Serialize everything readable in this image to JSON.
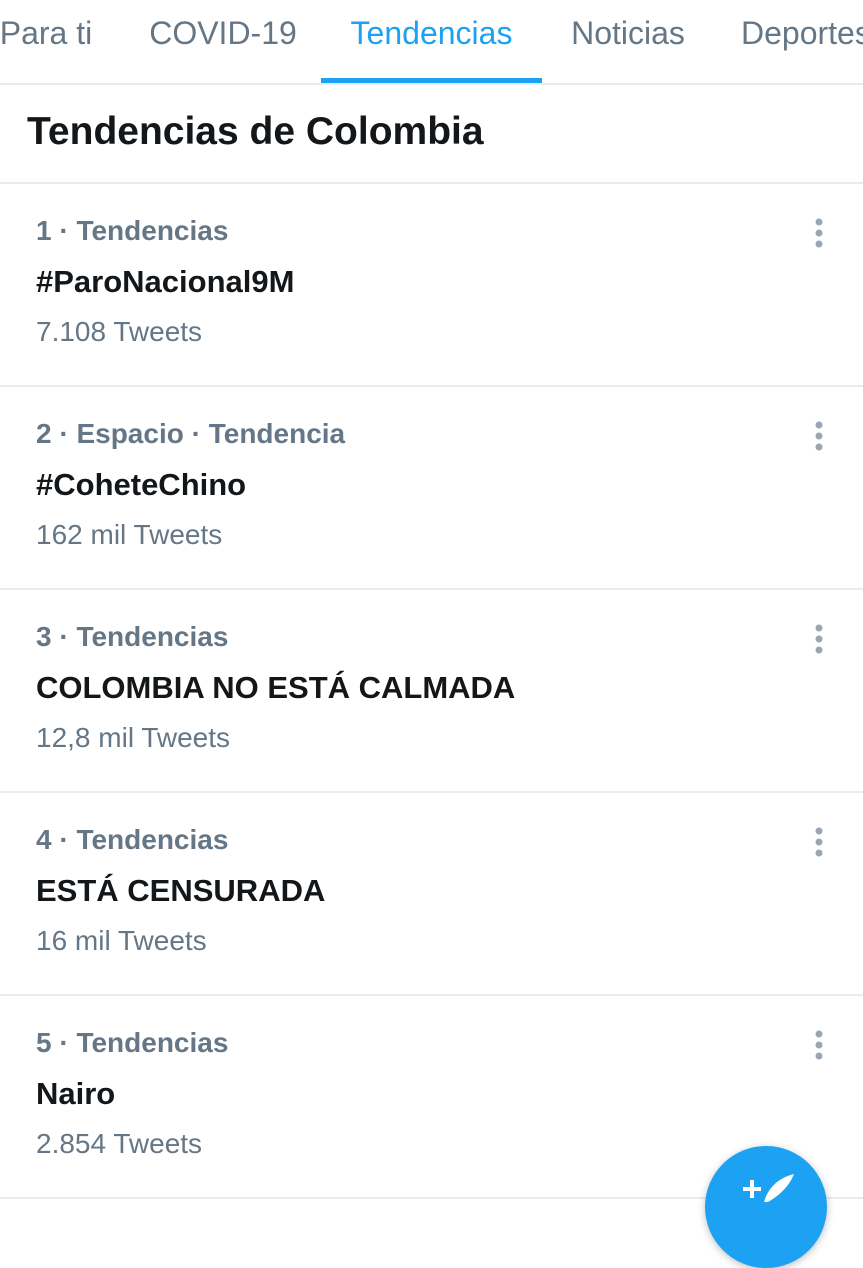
{
  "tabs": [
    {
      "label": "Para ti",
      "active": false
    },
    {
      "label": "COVID-19",
      "active": false
    },
    {
      "label": "Tendencias",
      "active": true
    },
    {
      "label": "Noticias",
      "active": false
    },
    {
      "label": "Deportes",
      "active": false
    }
  ],
  "section": {
    "title": "Tendencias de Colombia"
  },
  "trends": [
    {
      "meta": "1 · Tendencias",
      "name": "#ParoNacional9M",
      "count": "7.108 Tweets"
    },
    {
      "meta": "2 · Espacio · Tendencia",
      "name": "#CoheteChino",
      "count": "162 mil Tweets"
    },
    {
      "meta": "3 · Tendencias",
      "name": "COLOMBIA NO ESTÁ CALMADA",
      "count": "12,8 mil Tweets"
    },
    {
      "meta": "4 · Tendencias",
      "name": "ESTÁ CENSURADA",
      "count": "16 mil Tweets"
    },
    {
      "meta": "5 · Tendencias",
      "name": "Nairo",
      "count": "2.854 Tweets"
    }
  ],
  "icons": {
    "more": "more-vertical-icon",
    "compose": "compose-tweet-icon"
  },
  "colors": {
    "accent": "#1da1f2",
    "secondary_text": "#657786",
    "primary_text": "#14171a",
    "divider": "#e6ecf0"
  }
}
